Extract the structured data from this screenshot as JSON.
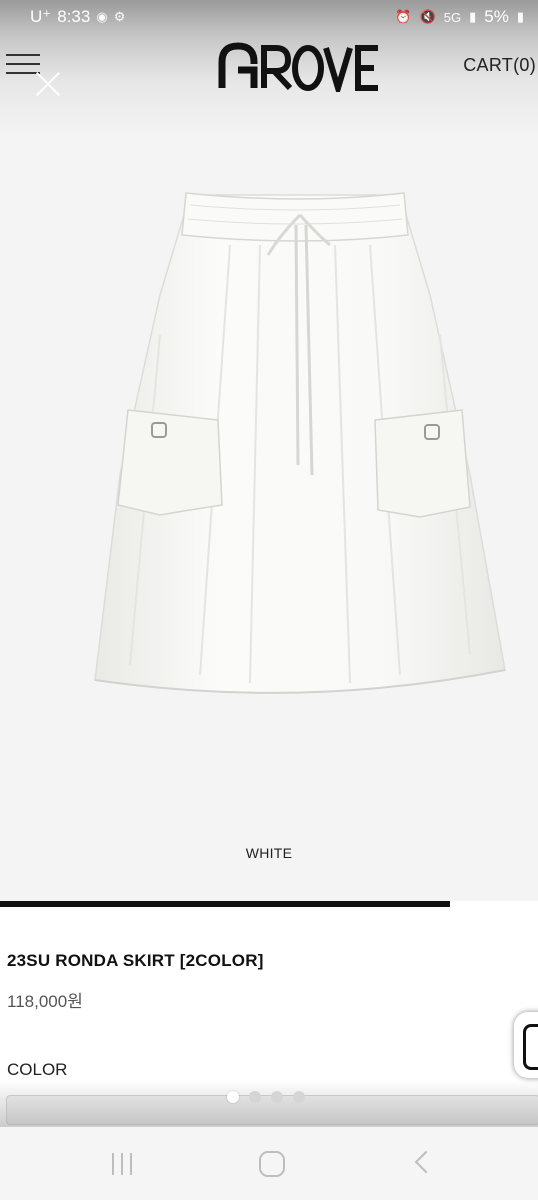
{
  "status_bar": {
    "carrier": "U⁺",
    "time": "8:33",
    "battery": "5%",
    "network": "5G"
  },
  "header": {
    "logo_text": "GROVE",
    "cart_label": "CART(0)"
  },
  "gallery": {
    "caption": "WHITE",
    "progress": 0.837,
    "slide_count": 4,
    "active_slide": 1
  },
  "product": {
    "name": "23SU RONDA SKIRT [2COLOR]",
    "price": "118,000원",
    "color_label": "COLOR"
  },
  "colors": {
    "progress_fill": "#111111",
    "accent": "#111111"
  }
}
